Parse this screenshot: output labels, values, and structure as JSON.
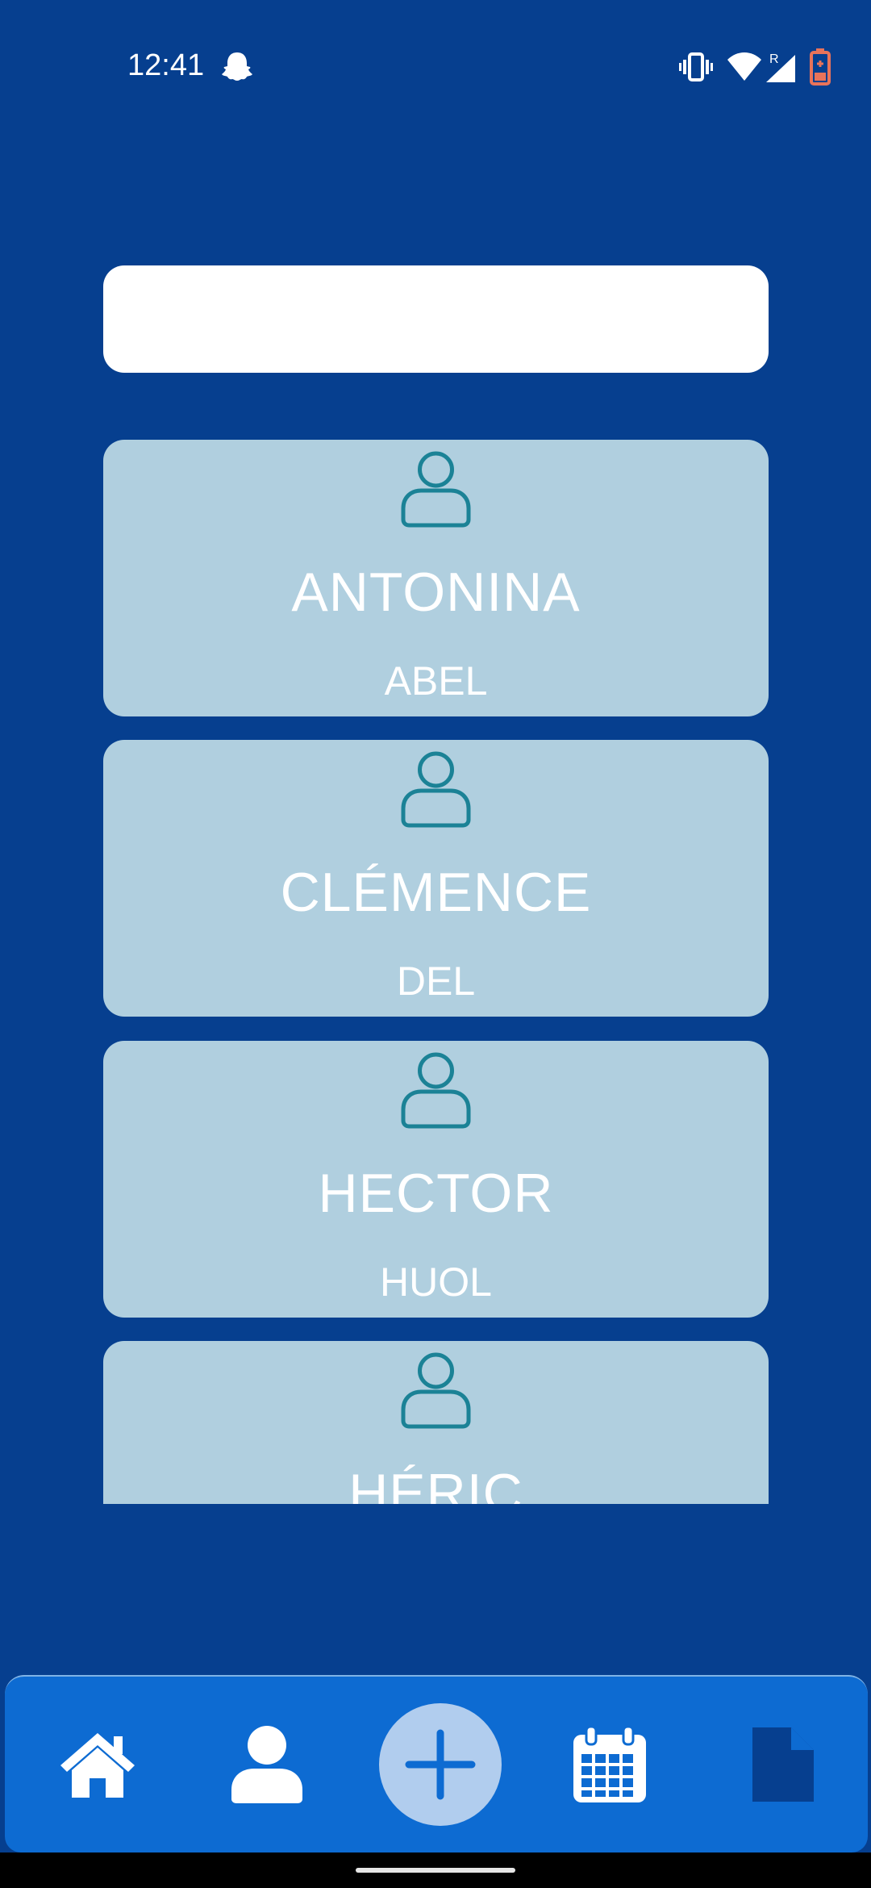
{
  "status_bar": {
    "time": "12:41",
    "roaming_indicator": "R",
    "icons": [
      "snapchat-ghost-icon",
      "vibrate-icon",
      "wifi-icon",
      "signal-icon",
      "battery-charging-icon"
    ]
  },
  "search": {
    "value": "",
    "placeholder": ""
  },
  "contacts": [
    {
      "first_name": "ANTONINA",
      "last_name": "ABEL",
      "icon": "person-icon"
    },
    {
      "first_name": "CLÉMENCE",
      "last_name": "DEL",
      "icon": "person-icon"
    },
    {
      "first_name": "HECTOR",
      "last_name": "HUOL",
      "icon": "person-icon"
    },
    {
      "first_name": "HÉRIC",
      "last_name": "",
      "icon": "person-icon"
    }
  ],
  "bottom_nav": {
    "items": [
      {
        "id": "home",
        "icon": "home-icon"
      },
      {
        "id": "profile",
        "icon": "person-icon"
      },
      {
        "id": "add",
        "icon": "plus-icon"
      },
      {
        "id": "calendar",
        "icon": "calendar-icon"
      },
      {
        "id": "document",
        "icon": "document-icon"
      }
    ]
  },
  "colors": {
    "background": "#063f8f",
    "card": "#b0cfdf",
    "avatar_stroke": "#1b8296",
    "nav_bar": "#0d6bd2",
    "add_button": "#b1cdee",
    "battery_warning": "#e8735a"
  }
}
